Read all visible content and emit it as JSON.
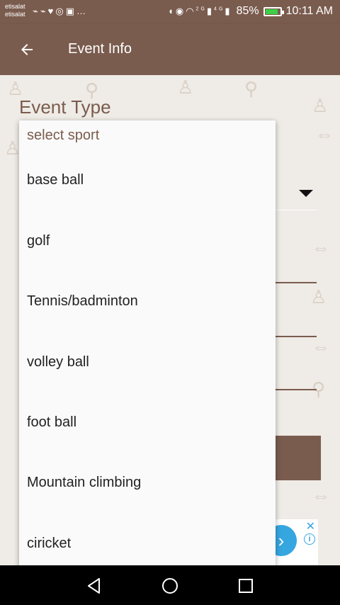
{
  "status_bar": {
    "carrier_line1": "etisalat",
    "carrier_line2": "etisalat",
    "battery_percent": "85%",
    "time": "10:11 AM",
    "network_labels": [
      "2G",
      "4G"
    ]
  },
  "app_bar": {
    "title": "Event Info"
  },
  "form": {
    "section_title": "Event Type"
  },
  "dropdown": {
    "prompt": "select sport",
    "options": [
      "base ball",
      "golf",
      "Tennis/badminton",
      "volley ball",
      "foot ball",
      "Mountain climbing",
      "ciricket"
    ]
  },
  "colors": {
    "primary": "#7a5c4e",
    "background": "#efebe6",
    "ad_accent": "#36a6e0",
    "battery_fill": "#3ccf47"
  },
  "icons": {
    "back": "arrow-left-icon",
    "nav": [
      "back-triangle-icon",
      "home-circle-icon",
      "recents-square-icon"
    ]
  }
}
